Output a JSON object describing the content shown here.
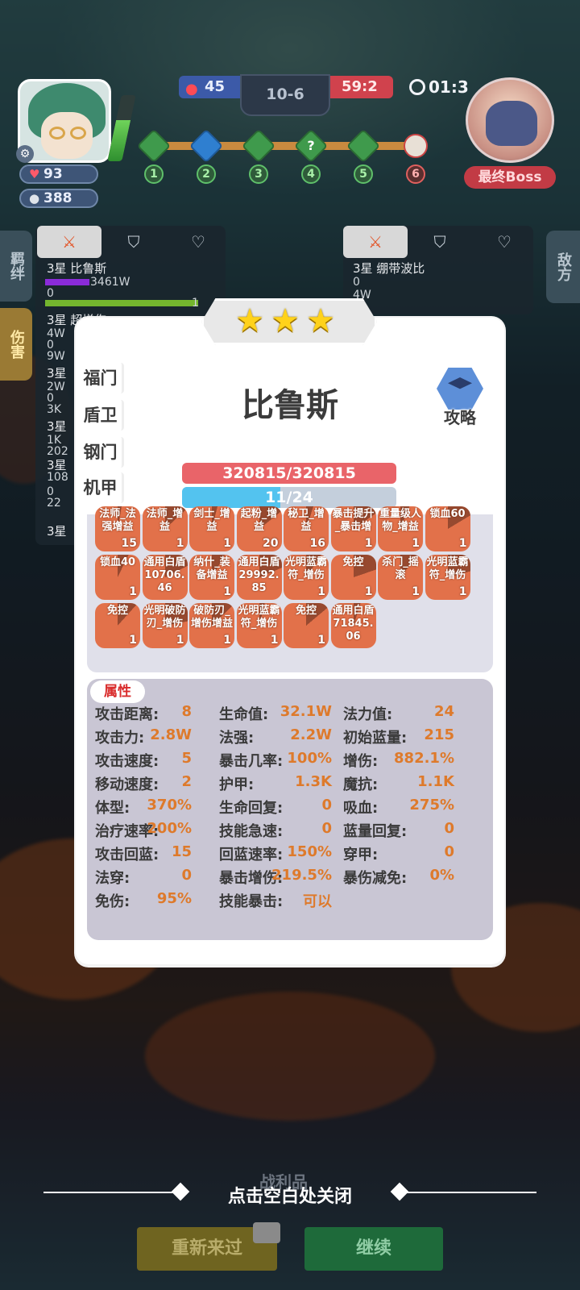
{
  "hud": {
    "player_hp": "93",
    "player_gold": "388",
    "energy_level": 0.62,
    "score_blue": "45",
    "stage": "10-6",
    "score_red": "59:2",
    "timer": "01:3",
    "stage_nodes": [
      "1",
      "2",
      "3",
      "4",
      "5",
      "6"
    ],
    "mystery_node_symbol": "?",
    "boss_label": "最终Boss"
  },
  "side_tabs": {
    "bond": "羁绊",
    "damage": "伤害",
    "enemy": "敌方"
  },
  "background_roster": {
    "left_top": "3星 比鲁斯",
    "left_top_value": "3461W",
    "left_zero": "0",
    "left_bar_value": "1",
    "left_lines": [
      "3星 超增伤",
      "4W",
      "0",
      "9W",
      "3星",
      "2W",
      "0",
      "3K",
      "3星",
      "1K",
      "202",
      "3星",
      "108",
      "0",
      "22",
      "3星"
    ],
    "right_top": "3星 绷带波比",
    "right_zero": "0",
    "right_value": "4W"
  },
  "modal": {
    "stars": 3,
    "hero_name": "比鲁斯",
    "guide_label": "攻略",
    "traits": [
      "福门",
      "盾卫",
      "钢门",
      "机甲"
    ],
    "hp_text": "320815/320815",
    "mp_text": "11/24",
    "mp_current": 11,
    "mp_max": 24,
    "buffs": [
      {
        "name": "法师_法强增益",
        "count": "15"
      },
      {
        "name": "法师_增益",
        "count": "1"
      },
      {
        "name": "剑士_增益",
        "count": "1"
      },
      {
        "name": "起粉_增益",
        "count": "20"
      },
      {
        "name": "秘卫_增益",
        "count": "16"
      },
      {
        "name": "暴击提升_暴击增",
        "count": "1"
      },
      {
        "name": "重量级人物_增益",
        "count": "1"
      },
      {
        "name": "锁血60",
        "count": "1"
      },
      {
        "name": "锁血40",
        "count": "1"
      },
      {
        "name": "通用白盾10706.46",
        "count": ""
      },
      {
        "name": "纳什_装备增益",
        "count": "1"
      },
      {
        "name": "通用白盾29992.85",
        "count": ""
      },
      {
        "name": "光明蓝霸符_增伤",
        "count": "1"
      },
      {
        "name": "免控",
        "count": "1"
      },
      {
        "name": "杀门_摇滚",
        "count": "1"
      },
      {
        "name": "光明蓝霸符_增伤",
        "count": "1"
      },
      {
        "name": "免控",
        "count": "1"
      },
      {
        "name": "光明破防刃_增伤",
        "count": "1"
      },
      {
        "name": "破防刃_增伤增益",
        "count": "1"
      },
      {
        "name": "光明蓝霸符_增伤",
        "count": "1"
      },
      {
        "name": "免控",
        "count": "1"
      },
      {
        "name": "通用白盾71845.06",
        "count": ""
      }
    ],
    "attr_title": "属性",
    "attributes": [
      [
        {
          "label": "攻击距离:",
          "value": "8"
        },
        {
          "label": "生命值:",
          "value": "32.1W"
        },
        {
          "label": "法力值:",
          "value": "24"
        }
      ],
      [
        {
          "label": "攻击力:",
          "value": "2.8W"
        },
        {
          "label": "法强:",
          "value": "2.2W"
        },
        {
          "label": "初始蓝量:",
          "value": "215"
        }
      ],
      [
        {
          "label": "攻击速度:",
          "value": "5"
        },
        {
          "label": "暴击几率:",
          "value": "100%"
        },
        {
          "label": "增伤:",
          "value": "882.1%"
        }
      ],
      [
        {
          "label": "移动速度:",
          "value": "2"
        },
        {
          "label": "护甲:",
          "value": "1.3K"
        },
        {
          "label": "魔抗:",
          "value": "1.1K"
        }
      ],
      [
        {
          "label": "体型:",
          "value": "370%"
        },
        {
          "label": "生命回复:",
          "value": "0"
        },
        {
          "label": "吸血:",
          "value": "275%"
        }
      ],
      [
        {
          "label": "治疗速率:",
          "value": "200%"
        },
        {
          "label": "技能急速:",
          "value": "0"
        },
        {
          "label": "蓝量回复:",
          "value": "0"
        }
      ],
      [
        {
          "label": "攻击回蓝:",
          "value": "15"
        },
        {
          "label": "回蓝速率:",
          "value": "150%"
        },
        {
          "label": "穿甲:",
          "value": "0"
        }
      ],
      [
        {
          "label": "法穿:",
          "value": "0"
        },
        {
          "label": "暴击增伤:",
          "value": "219.5%"
        },
        {
          "label": "暴伤减免:",
          "value": "0%"
        }
      ],
      [
        {
          "label": "免伤:",
          "value": "95%"
        },
        {
          "label": "技能暴击:",
          "value": "可以"
        },
        null
      ]
    ]
  },
  "footer": {
    "close_hint": "点击空白处关闭",
    "faint_label": "战利品",
    "retry_label": "重新来过",
    "continue_label": "继续"
  },
  "colors": {
    "accent_orange": "#de7a2b",
    "buff_orange": "#e2714a",
    "hp_red": "#e96469",
    "mp_blue": "#53c3ef"
  }
}
